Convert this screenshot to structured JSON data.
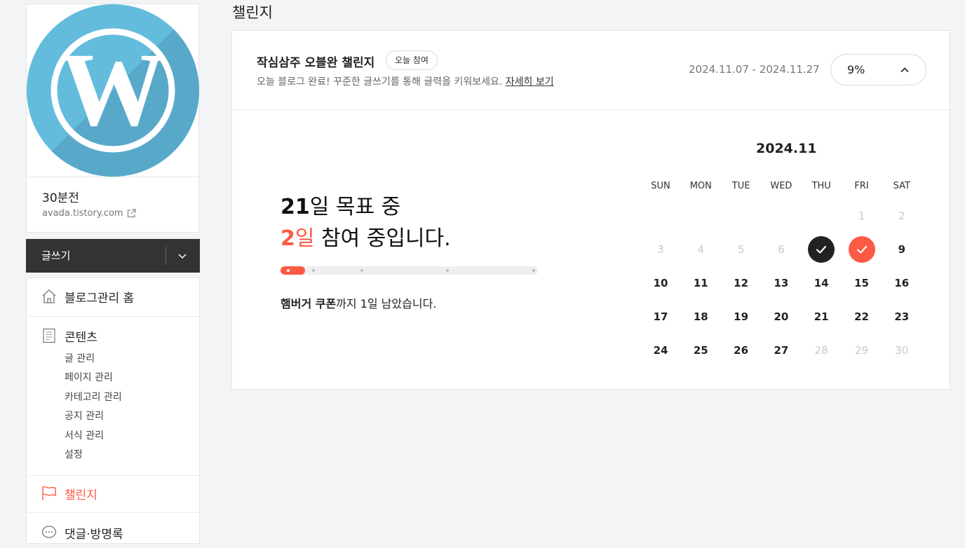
{
  "sidebar": {
    "blog_name": "30분전",
    "blog_url": "avada.tistory.com",
    "write_label": "글쓰기",
    "menu": {
      "home": "블로그관리 홈",
      "contents": "콘텐츠",
      "contents_items": [
        "글 관리",
        "페이지 관리",
        "카테고리 관리",
        "공지 관리",
        "서식 관리",
        "설정"
      ],
      "challenge": "챌린지",
      "comments": "댓글·방명록"
    },
    "accent_color": "#fb5a44"
  },
  "main": {
    "page_title": "챌린지",
    "challenge": {
      "title": "작심삼주 오블완 챌린지",
      "badge": "오늘 참여",
      "description": "오늘 블로그 완료! 꾸준한 글쓰기를 통해 글력을 키워보세요.",
      "detail_link": "자세히 보기",
      "period": "2024.11.07 - 2024.11.27",
      "progress_percent": "9%"
    },
    "goal": {
      "goal_days": "21",
      "goal_suffix": "일 목표 중",
      "joined_days": "2",
      "joined_unit": "일",
      "joined_suffix": " 참여 중입니다.",
      "progress_fraction": 0.095
    },
    "reward": {
      "item": "햄버거 쿠폰",
      "suffix": "까지 1일 남았습니다."
    },
    "calendar": {
      "month": "2024.11",
      "weekdays": [
        "SUN",
        "MON",
        "TUE",
        "WED",
        "THU",
        "FRI",
        "SAT"
      ],
      "weeks": [
        [
          "",
          "",
          "",
          "",
          "",
          "1",
          "2"
        ],
        [
          "3",
          "4",
          "5",
          "6",
          "7",
          "8",
          "9"
        ],
        [
          "10",
          "11",
          "12",
          "13",
          "14",
          "15",
          "16"
        ],
        [
          "17",
          "18",
          "19",
          "20",
          "21",
          "22",
          "23"
        ],
        [
          "24",
          "25",
          "26",
          "27",
          "28",
          "29",
          "30"
        ]
      ],
      "dimmed_days": [
        "1",
        "2",
        "3",
        "4",
        "5",
        "6",
        "28",
        "29",
        "30"
      ],
      "completed_days": [
        "7",
        "8"
      ],
      "today": "8"
    }
  }
}
